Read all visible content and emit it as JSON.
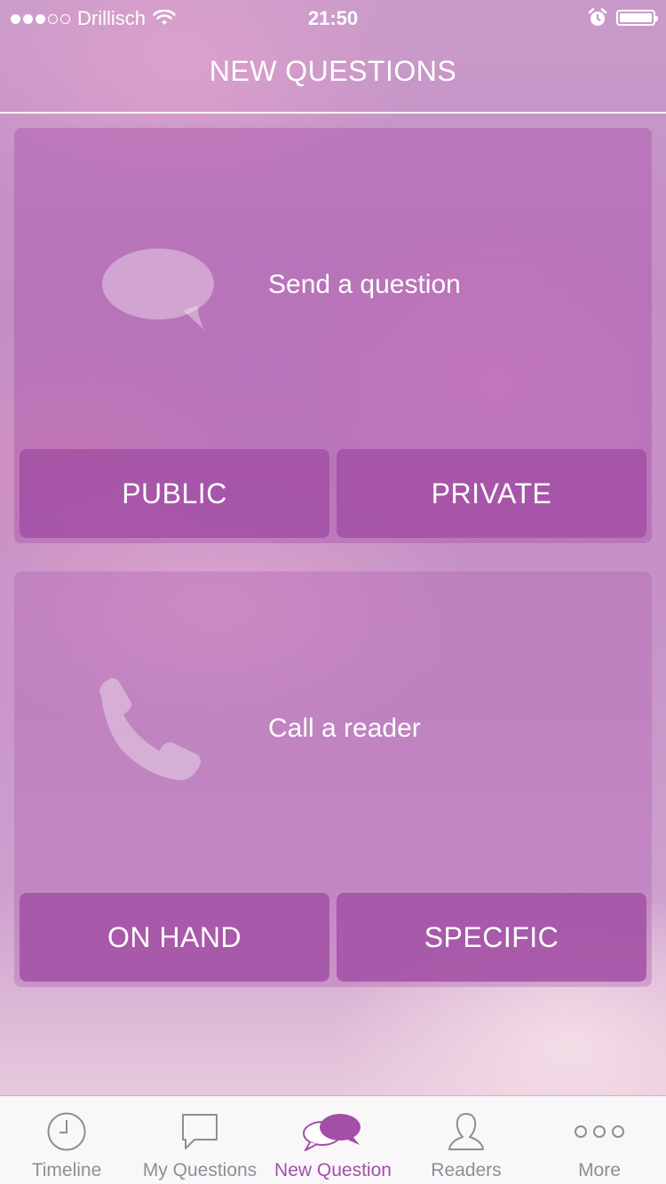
{
  "status_bar": {
    "carrier": "Drillisch",
    "time": "21:50",
    "signal_bars_filled": 3,
    "signal_bars_total": 5,
    "icons": [
      "wifi-icon",
      "alarm-icon",
      "battery-icon"
    ]
  },
  "nav": {
    "title": "NEW QUESTIONS"
  },
  "cards": [
    {
      "icon": "speech-bubble-icon",
      "text": "Send a question",
      "buttons": [
        "PUBLIC",
        "PRIVATE"
      ]
    },
    {
      "icon": "phone-icon",
      "text": "Call a reader",
      "buttons": [
        "ON HAND",
        "SPECIFIC"
      ]
    }
  ],
  "tab_bar": {
    "active_index": 2,
    "items": [
      {
        "label": "Timeline",
        "icon": "clock-icon"
      },
      {
        "label": "My Questions",
        "icon": "speech-bubble-outline-icon"
      },
      {
        "label": "New Question",
        "icon": "double-speech-bubble-icon"
      },
      {
        "label": "Readers",
        "icon": "person-icon"
      },
      {
        "label": "More",
        "icon": "more-dots-icon"
      }
    ]
  },
  "colors": {
    "accent": "#a24fa8",
    "button": "#a250a4",
    "tab_inactive": "#8e8e93"
  }
}
